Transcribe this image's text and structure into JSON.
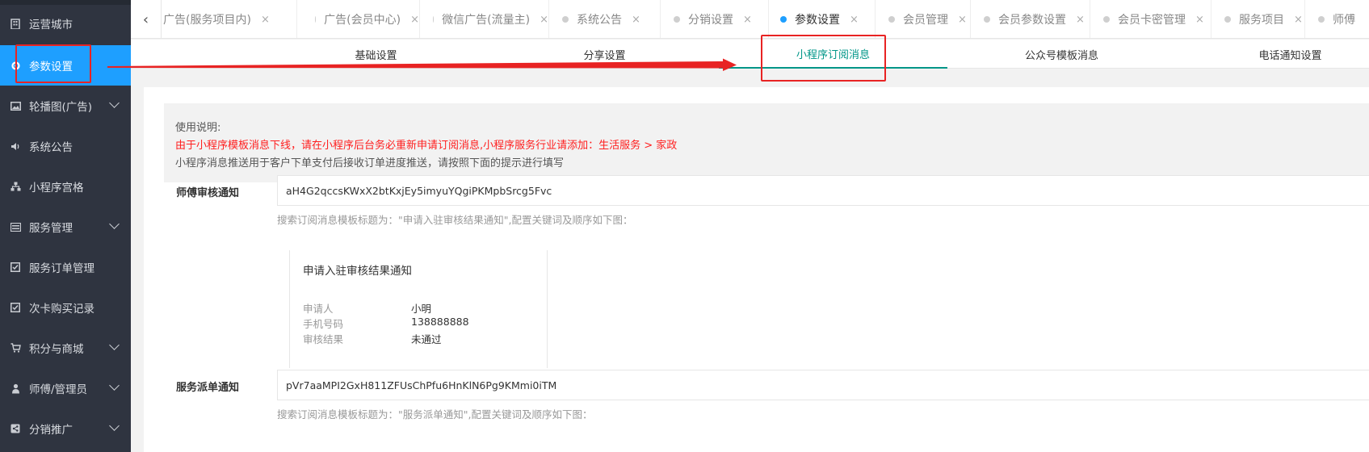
{
  "sidebar": {
    "items": [
      {
        "label": "运营城市",
        "icon": "building-icon",
        "active": false,
        "has_sub": false
      },
      {
        "label": "参数设置",
        "icon": "gear-icon",
        "active": true,
        "has_sub": false
      },
      {
        "label": "轮播图(广告)",
        "icon": "image-icon",
        "active": false,
        "has_sub": true
      },
      {
        "label": "系统公告",
        "icon": "speaker-icon",
        "active": false,
        "has_sub": false
      },
      {
        "label": "小程序宫格",
        "icon": "sitemap-icon",
        "active": false,
        "has_sub": false
      },
      {
        "label": "服务管理",
        "icon": "list-icon",
        "active": false,
        "has_sub": true
      },
      {
        "label": "服务订单管理",
        "icon": "check-square-icon",
        "active": false,
        "has_sub": false
      },
      {
        "label": "次卡购买记录",
        "icon": "check-square-icon",
        "active": false,
        "has_sub": false
      },
      {
        "label": "积分与商城",
        "icon": "cart-icon",
        "active": false,
        "has_sub": true
      },
      {
        "label": "师傅/管理员",
        "icon": "user-icon",
        "active": false,
        "has_sub": true
      },
      {
        "label": "分销推广",
        "icon": "share-icon",
        "active": false,
        "has_sub": true
      }
    ]
  },
  "tabs": {
    "items": [
      {
        "label": "广告(服务项目内)",
        "active": false
      },
      {
        "label": "广告(会员中心)",
        "active": false
      },
      {
        "label": "微信广告(流量主)",
        "active": false
      },
      {
        "label": "系统公告",
        "active": false
      },
      {
        "label": "分销设置",
        "active": false
      },
      {
        "label": "参数设置",
        "active": true
      },
      {
        "label": "会员管理",
        "active": false
      },
      {
        "label": "会员参数设置",
        "active": false
      },
      {
        "label": "会员卡密管理",
        "active": false
      },
      {
        "label": "服务项目",
        "active": false
      },
      {
        "label": "师傅",
        "active": false
      }
    ],
    "close_glyph": "×"
  },
  "subtabs": {
    "items": [
      {
        "label": "基础设置",
        "active": false
      },
      {
        "label": "分享设置",
        "active": false
      },
      {
        "label": "小程序订阅消息",
        "active": true
      },
      {
        "label": "公众号模板消息",
        "active": false
      },
      {
        "label": "电话通知设置",
        "active": false
      }
    ]
  },
  "notice": {
    "line1": "使用说明:",
    "line2": "由于小程序模板消息下线，请在小程序后台务必重新申请订阅消息,小程序服务行业请添加：生活服务 > 家政",
    "line3": "小程序消息推送用于客户下单支付后接收订单进度推送，请按照下面的提示进行填写"
  },
  "fields": {
    "audit": {
      "label": "师傅审核通知",
      "value": "aH4G2qccsKWxX2btKxjEy5imyuYQgiPKMpbSrcg5Fvc",
      "hint": "搜索订阅消息模板标题为：\"申请入驻审核结果通知\",配置关键词及顺序如下图："
    },
    "dispatch": {
      "label": "服务派单通知",
      "value": "pVr7aaMPI2GxH811ZFUsChPfu6HnKlN6Pg9KMmi0iTM",
      "hint": "搜索订阅消息模板标题为：\"服务派单通知\",配置关键词及顺序如下图："
    }
  },
  "template_card": {
    "title": "申请入驻审核结果通知",
    "rows": [
      {
        "key": "申请人",
        "value": "小明"
      },
      {
        "key": "手机号码",
        "value": "138888888"
      },
      {
        "key": "审核结果",
        "value": "未通过"
      }
    ]
  },
  "colors": {
    "sidebar_bg": "#2f3440",
    "active_blue": "#1e9fff",
    "active_subtab": "#009688",
    "annotation_red": "#e82323",
    "notice_red": "#ff1e1e"
  }
}
